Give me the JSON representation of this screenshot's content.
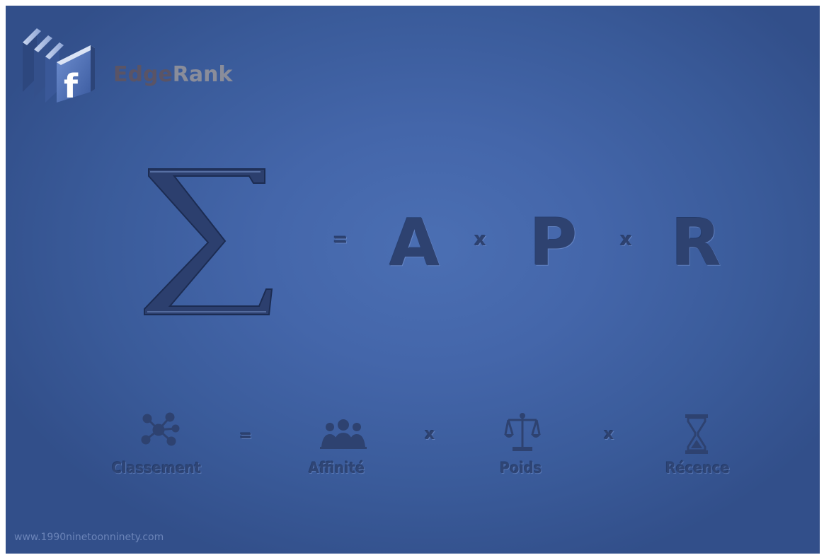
{
  "brand": {
    "part1": "Edge",
    "part2": "Rank"
  },
  "logo": {
    "icon": "facebook-blocks-logo",
    "letter": "f"
  },
  "formula": {
    "sigma": "Σ",
    "equals": "=",
    "a": "A",
    "times1": "x",
    "p": "P",
    "times2": "x",
    "r": "R"
  },
  "legend": {
    "classement": {
      "icon": "network-icon",
      "label": "Classement"
    },
    "equals": "=",
    "affinite": {
      "icon": "group-icon",
      "label": "Affinité"
    },
    "times1": "x",
    "poids": {
      "icon": "scales-icon",
      "label": "Poids"
    },
    "times2": "x",
    "recence": {
      "icon": "hourglass-icon",
      "label": "Récence"
    }
  },
  "footer": {
    "url": "www.1990ninetoonninety.com"
  },
  "colors": {
    "background": "#4466aa",
    "engraved": "#2e4270"
  }
}
